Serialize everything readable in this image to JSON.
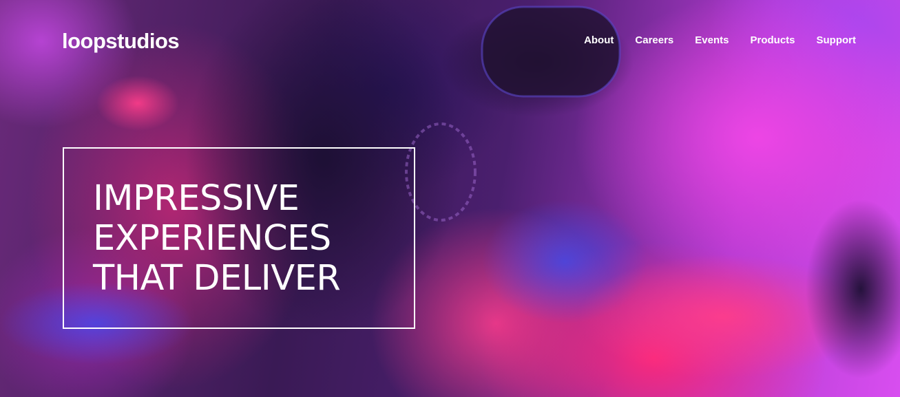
{
  "header": {
    "logo": "loopstudios",
    "nav": [
      {
        "label": "About"
      },
      {
        "label": "Careers"
      },
      {
        "label": "Events"
      },
      {
        "label": "Products"
      },
      {
        "label": "Support"
      }
    ]
  },
  "hero": {
    "headline_lines": [
      "IMPRESSIVE",
      "EXPERIENCES",
      "THAT DELIVER"
    ]
  },
  "colors": {
    "text": "#ffffff",
    "box_border": "#ffffff",
    "accent_magenta": "#e046f0",
    "accent_pink": "#ff2878",
    "deep_purple": "#3a1a55"
  }
}
